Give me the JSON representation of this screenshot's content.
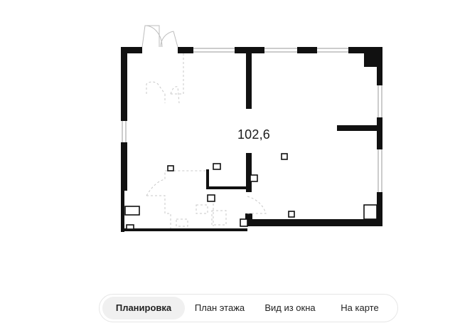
{
  "plan": {
    "area": "102,6"
  },
  "tabs": [
    {
      "label": "Планировка",
      "active": true
    },
    {
      "label": "План этажа",
      "active": false
    },
    {
      "label": "Вид из окна",
      "active": false
    },
    {
      "label": "На карте",
      "active": false
    }
  ]
}
